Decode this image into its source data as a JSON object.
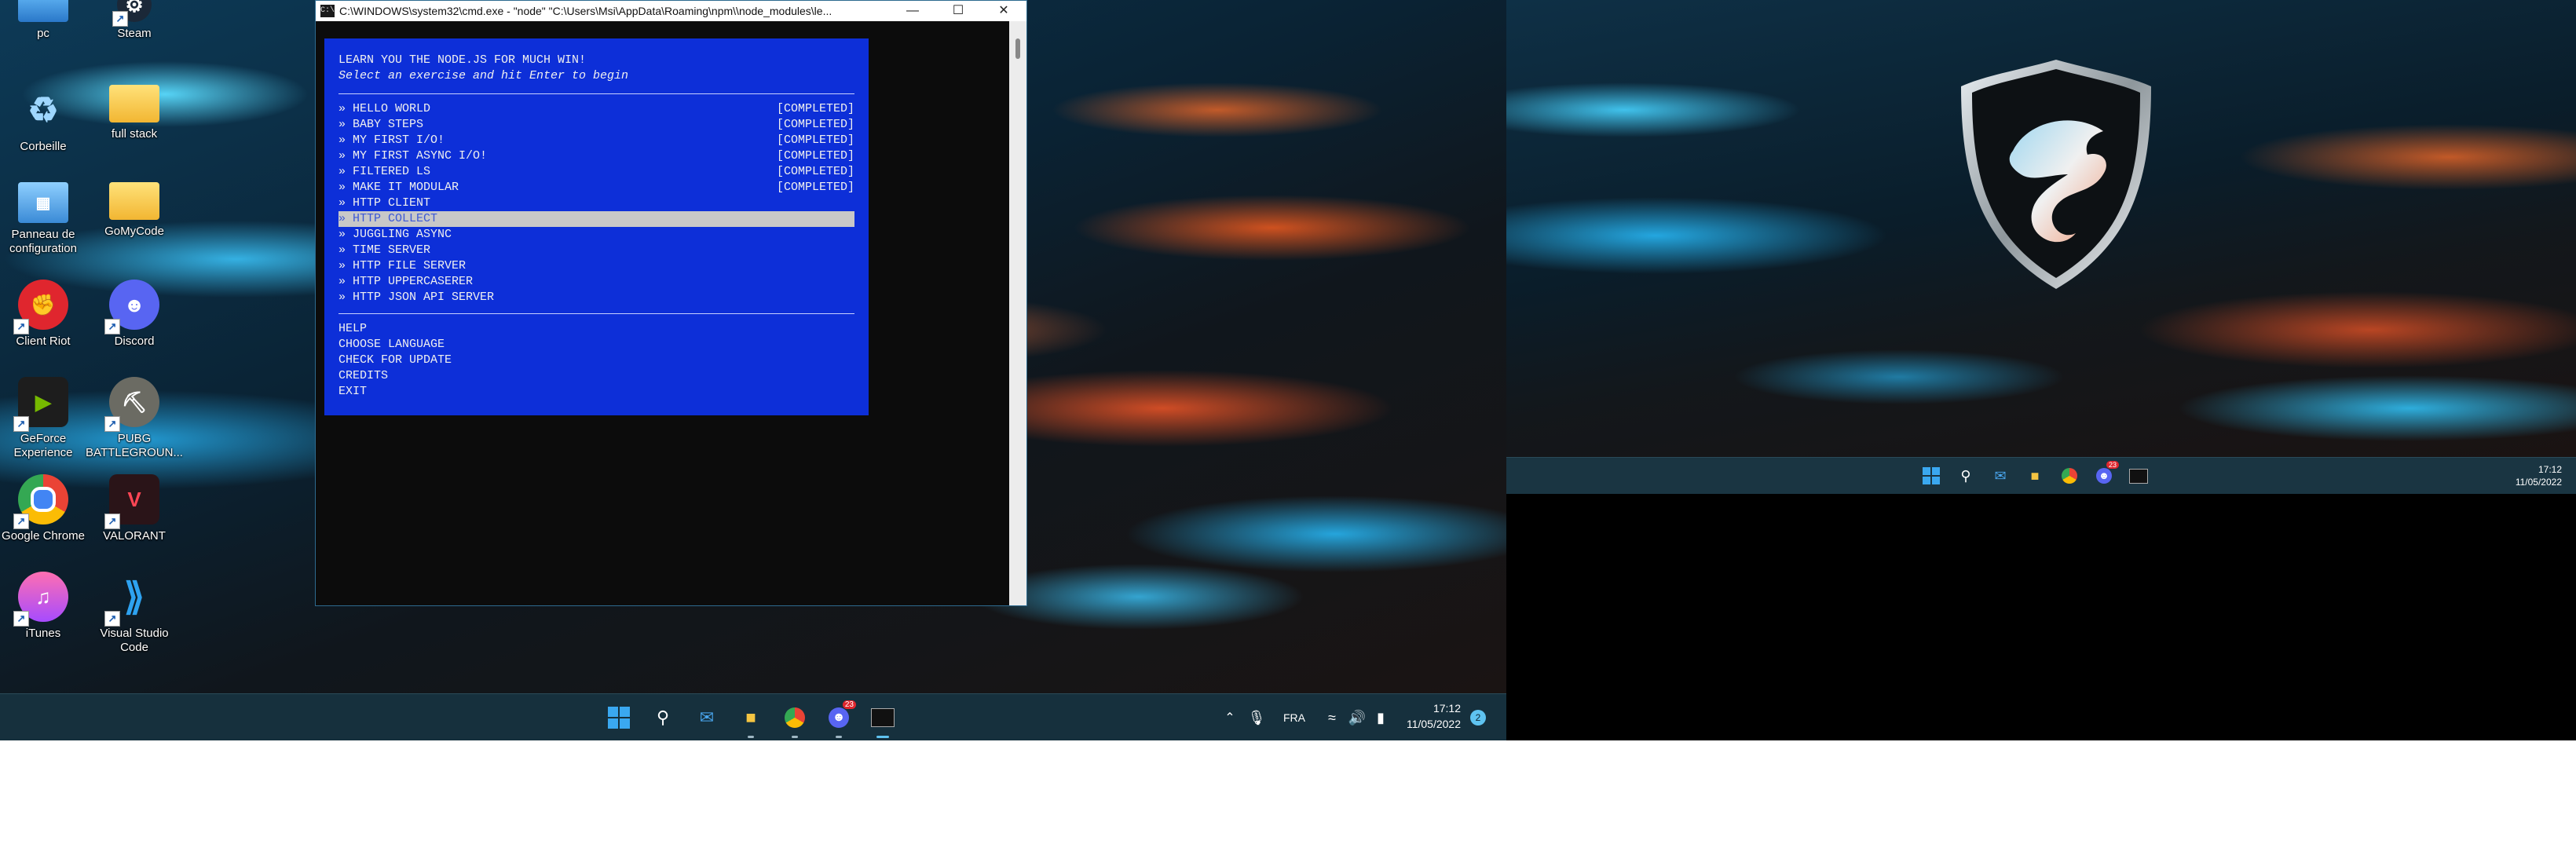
{
  "desktop_icons": [
    {
      "id": "pc",
      "label": "pc"
    },
    {
      "id": "steam",
      "label": "Steam"
    },
    {
      "id": "corbeille",
      "label": "Corbeille"
    },
    {
      "id": "full-stack",
      "label": "full stack"
    },
    {
      "id": "panneau",
      "label": "Panneau de configuration"
    },
    {
      "id": "gomycode",
      "label": "GoMyCode"
    },
    {
      "id": "riot",
      "label": "Client Riot"
    },
    {
      "id": "discord",
      "label": "Discord"
    },
    {
      "id": "geforce",
      "label": "GeForce Experience"
    },
    {
      "id": "pubg",
      "label": "PUBG BATTLEGROUN..."
    },
    {
      "id": "chrome",
      "label": "Google Chrome"
    },
    {
      "id": "valorant",
      "label": "VALORANT"
    },
    {
      "id": "itunes",
      "label": "iTunes"
    },
    {
      "id": "vscode",
      "label": "Visual Studio Code"
    }
  ],
  "cmd": {
    "title": "C:\\WINDOWS\\system32\\cmd.exe - \"node\"   \"C:\\Users\\Msi\\AppData\\Roaming\\npm\\\\node_modules\\le...",
    "icon_text": "C:\\",
    "minimize": "—",
    "maximize": "☐",
    "close": "✕",
    "heading": "LEARN YOU THE NODE.JS FOR MUCH WIN!",
    "subheading": "Select an exercise and hit Enter to begin",
    "exercises": [
      {
        "label": "» HELLO WORLD",
        "status": "[COMPLETED]"
      },
      {
        "label": "» BABY STEPS",
        "status": "[COMPLETED]"
      },
      {
        "label": "» MY FIRST I/O!",
        "status": "[COMPLETED]"
      },
      {
        "label": "» MY FIRST ASYNC I/O!",
        "status": "[COMPLETED]"
      },
      {
        "label": "» FILTERED LS",
        "status": "[COMPLETED]"
      },
      {
        "label": "» MAKE IT MODULAR",
        "status": "[COMPLETED]"
      },
      {
        "label": "» HTTP CLIENT",
        "status": ""
      },
      {
        "label": "» HTTP COLLECT",
        "status": "",
        "selected": true
      },
      {
        "label": "» JUGGLING ASYNC",
        "status": ""
      },
      {
        "label": "» TIME SERVER",
        "status": ""
      },
      {
        "label": "» HTTP FILE SERVER",
        "status": ""
      },
      {
        "label": "» HTTP UPPERCASERER",
        "status": ""
      },
      {
        "label": "» HTTP JSON API SERVER",
        "status": ""
      }
    ],
    "options": [
      "HELP",
      "CHOOSE LANGUAGE",
      "CHECK FOR UPDATE",
      "CREDITS",
      "EXIT"
    ]
  },
  "taskbar1": {
    "discord_badge": "23",
    "language": "FRA",
    "time": "17:12",
    "date": "11/05/2022",
    "notifications": "2"
  },
  "taskbar2": {
    "discord_badge": "23",
    "time": "17:12",
    "date": "11/05/2022"
  },
  "colors": {
    "menu_bg": "#0d2fd8",
    "selected_bg": "#c8c8c8",
    "taskbar": "#16303d"
  }
}
